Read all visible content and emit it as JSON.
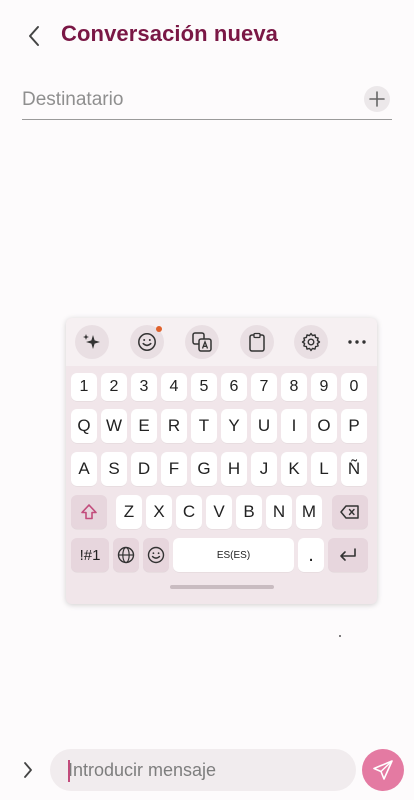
{
  "header": {
    "title": "Conversación nueva"
  },
  "recipient": {
    "placeholder": "Destinatario"
  },
  "keyboard": {
    "number_row": [
      "1",
      "2",
      "3",
      "4",
      "5",
      "6",
      "7",
      "8",
      "9",
      "0"
    ],
    "row1": [
      "Q",
      "W",
      "E",
      "R",
      "T",
      "Y",
      "U",
      "I",
      "O",
      "P"
    ],
    "row2": [
      "A",
      "S",
      "D",
      "F",
      "G",
      "H",
      "J",
      "K",
      "L",
      "Ñ"
    ],
    "row3": [
      "Z",
      "X",
      "C",
      "V",
      "B",
      "N",
      "M"
    ],
    "symbols_label": "!#1",
    "space_label": "ES(ES)",
    "period_label": "."
  },
  "composer": {
    "placeholder": "Introducir mensaje"
  },
  "colors": {
    "accent": "#7a1745",
    "send": "#e47aa2",
    "caret": "#c24c7c",
    "badge": "#e0612c"
  }
}
